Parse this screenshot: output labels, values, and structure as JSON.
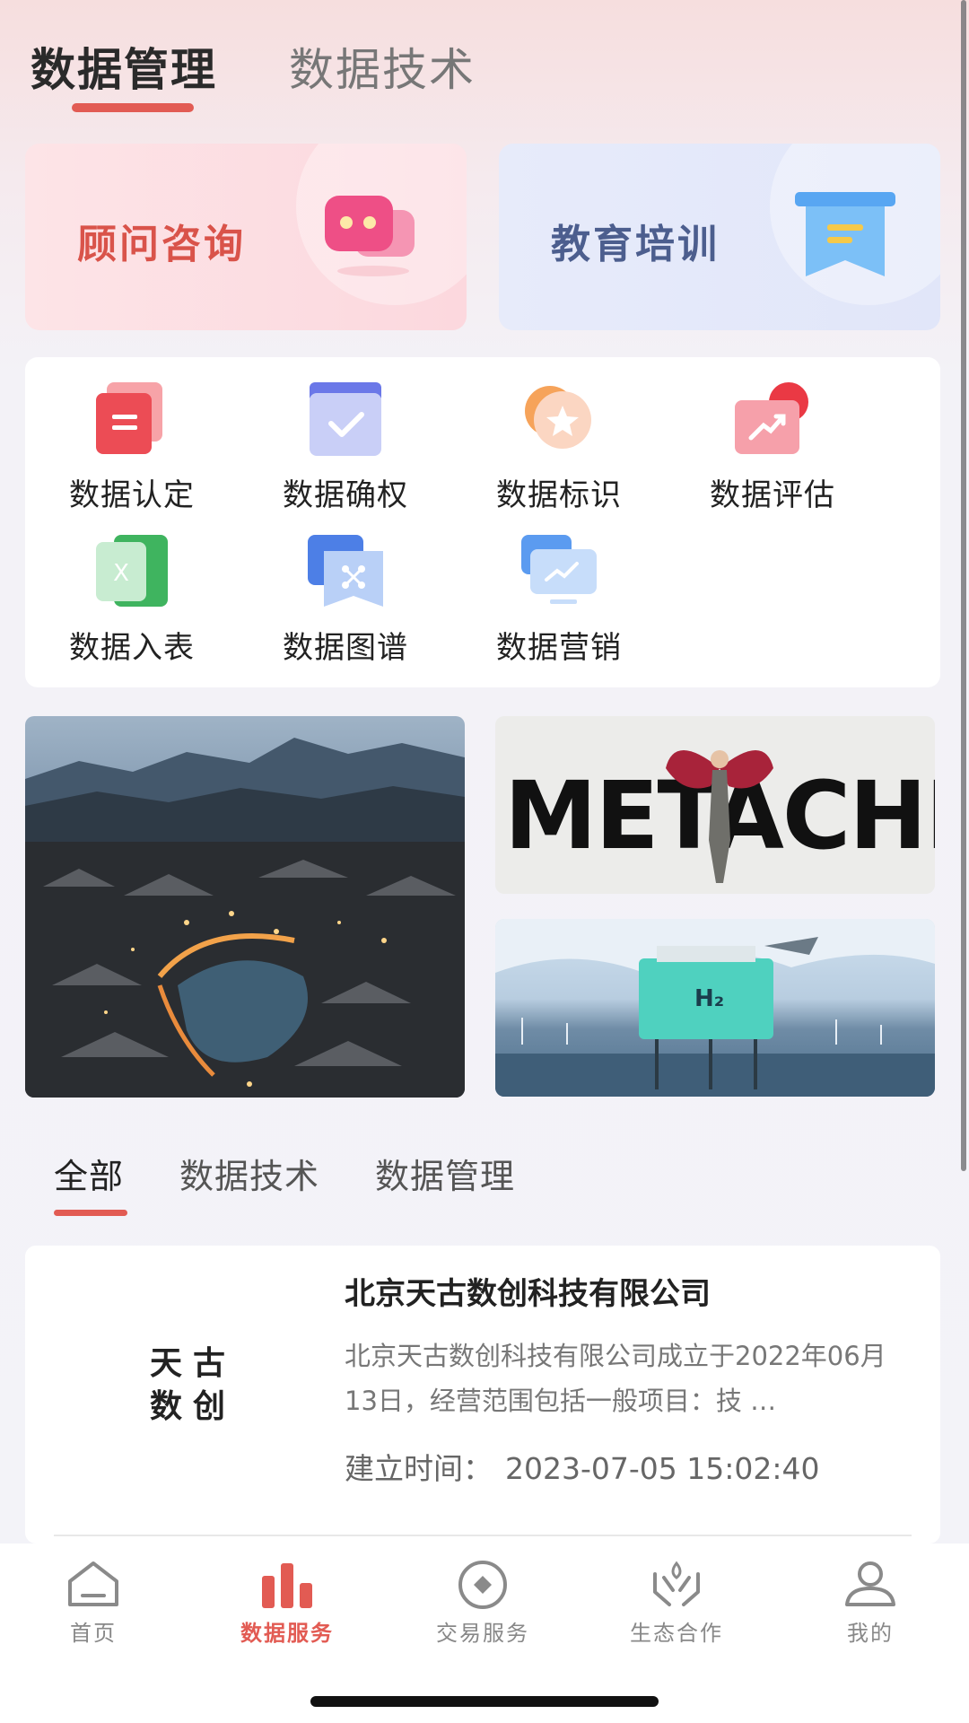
{
  "top_tabs": [
    {
      "label": "数据管理",
      "active": true
    },
    {
      "label": "数据技术",
      "active": false
    }
  ],
  "services": [
    {
      "label": "顾问咨询",
      "icon": "chat-bubbles-icon",
      "color": "#d9534a"
    },
    {
      "label": "教育培训",
      "icon": "training-board-icon",
      "color": "#4c5e8e"
    }
  ],
  "features": [
    {
      "label": "数据认定",
      "icon": "document-certify-icon"
    },
    {
      "label": "数据确权",
      "icon": "checkmark-folder-icon"
    },
    {
      "label": "数据标识",
      "icon": "star-badge-icon"
    },
    {
      "label": "数据评估",
      "icon": "trend-chart-icon"
    },
    {
      "label": "数据入表",
      "icon": "spreadsheet-icon"
    },
    {
      "label": "数据图谱",
      "icon": "graph-network-icon"
    },
    {
      "label": "数据营销",
      "icon": "monitor-marketing-icon"
    }
  ],
  "banners": {
    "metachi_text": "METACHI",
    "hydrogen_label": "H₂"
  },
  "sub_tabs": [
    {
      "label": "全部",
      "active": true
    },
    {
      "label": "数据技术",
      "active": false
    },
    {
      "label": "数据管理",
      "active": false
    }
  ],
  "company": {
    "logo_text": "天古数创",
    "name": "北京天古数创科技有限公司",
    "description": "北京天古数创科技有限公司成立于2022年06月13日，经营范围包括一般项目：技 …",
    "created_label": "建立时间：",
    "created_time": "2023-07-05 15:02:40",
    "time_line": "建立时间：  2023-07-05 15:02:40"
  },
  "bottom_nav": [
    {
      "label": "首页",
      "icon": "home-icon",
      "active": false
    },
    {
      "label": "数据服务",
      "icon": "bar-chart-icon",
      "active": true
    },
    {
      "label": "交易服务",
      "icon": "trade-icon",
      "active": false
    },
    {
      "label": "生态合作",
      "icon": "cooperation-hands-icon",
      "active": false
    },
    {
      "label": "我的",
      "icon": "profile-icon",
      "active": false
    }
  ],
  "colors": {
    "accent": "#e25b53",
    "card_bg": "#ffffff",
    "page_bg": "#f3f3f8"
  }
}
